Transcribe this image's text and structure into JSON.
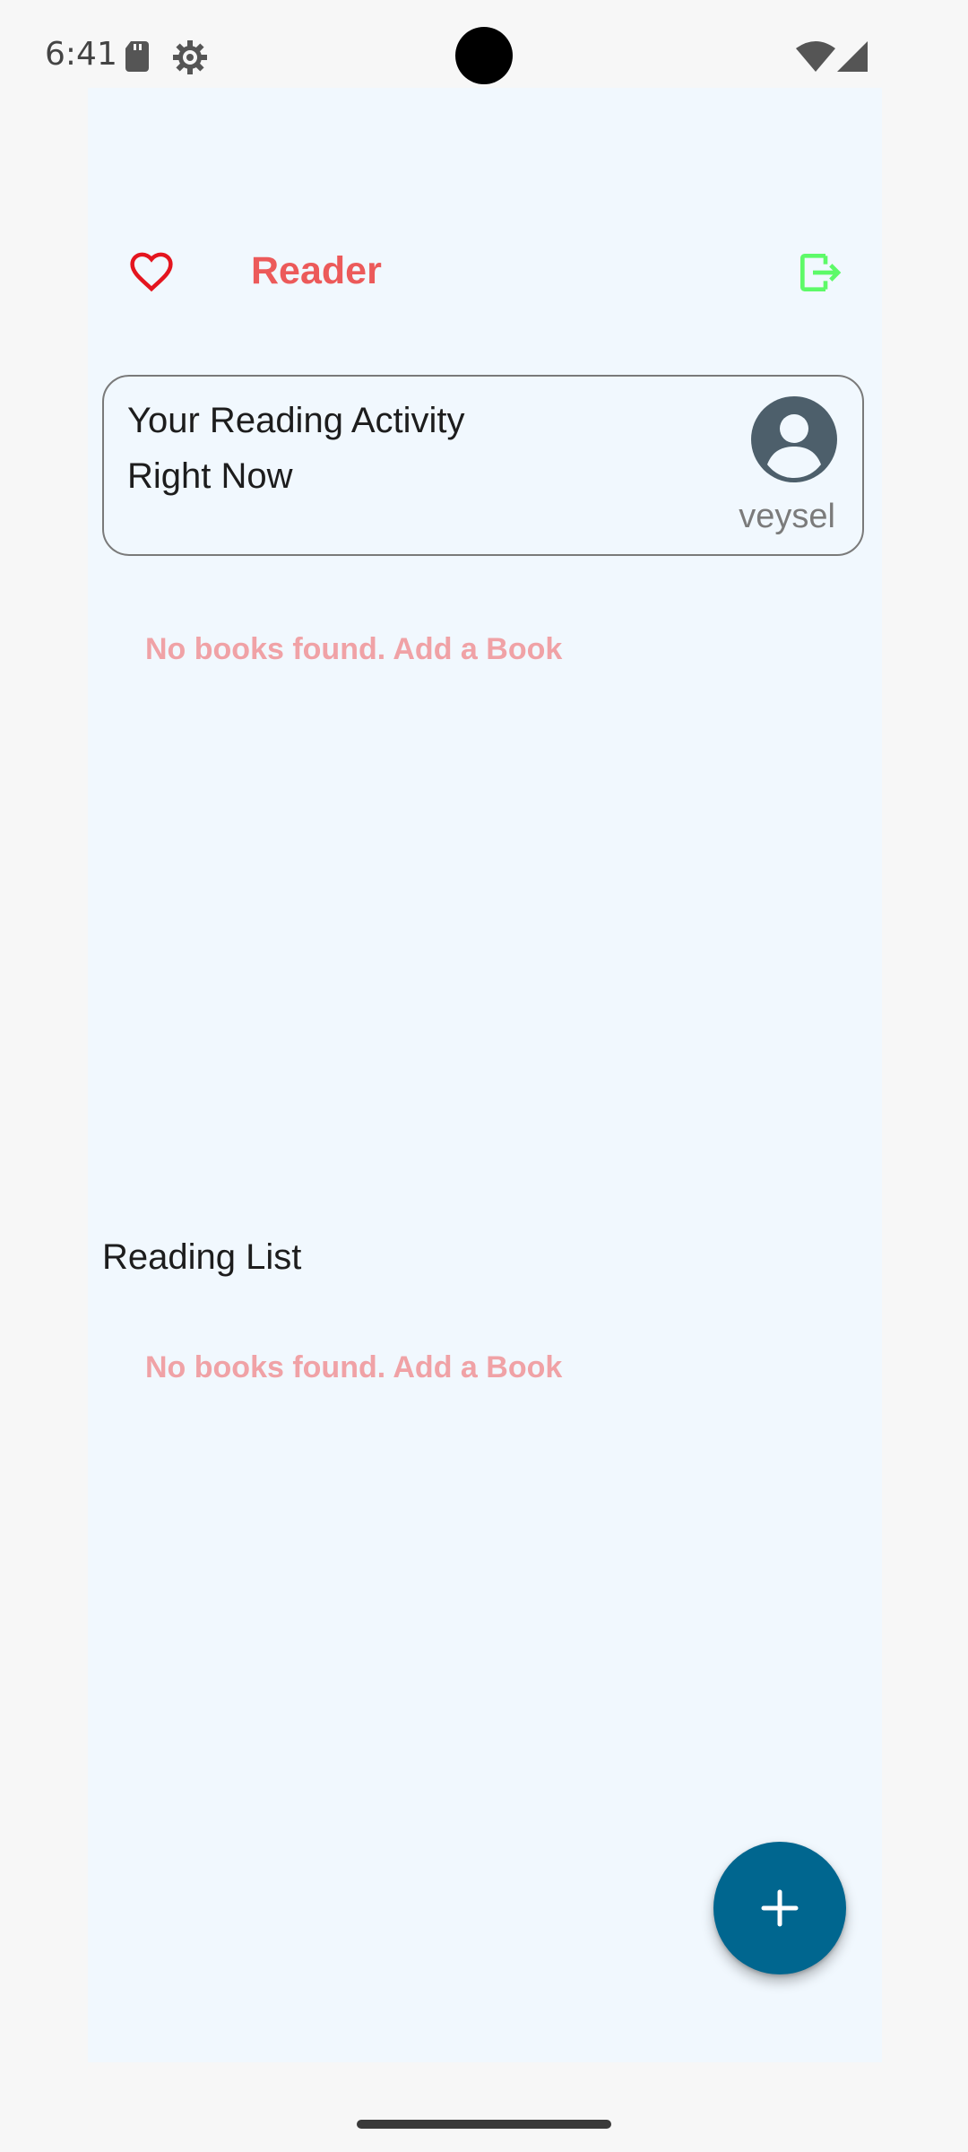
{
  "status_bar": {
    "time": "6:41",
    "icons": [
      "sd-card-icon",
      "settings-gear-icon",
      "wifi-icon",
      "cell-signal-icon"
    ]
  },
  "header": {
    "title": "Reader",
    "left_icon": "heart-outline-icon",
    "right_icon": "logout-icon"
  },
  "activity_card": {
    "title": "Your Reading Activity Right Now",
    "avatar_icon": "account-circle-icon",
    "username": "veysel"
  },
  "current_reading": {
    "empty_message": "No books found. Add a Book"
  },
  "reading_list": {
    "title": "Reading List",
    "empty_message": "No books found. Add a Book"
  },
  "fab": {
    "icon": "plus-icon"
  },
  "colors": {
    "accent_red": "#ec5a5a",
    "empty_text": "#f0a2a6",
    "logout_green": "#5dfa68",
    "fab_blue": "#00668f",
    "panel_bg": "#f1f8fe"
  }
}
